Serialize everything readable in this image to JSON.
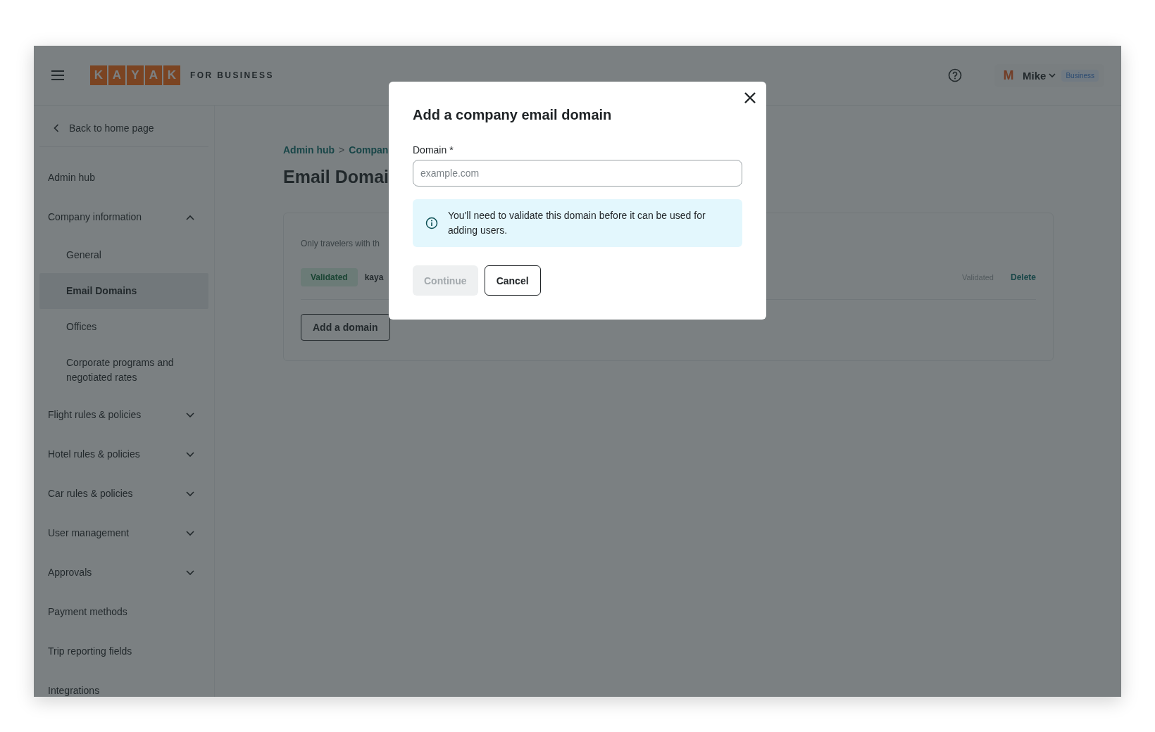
{
  "header": {
    "logo_letters": [
      "K",
      "A",
      "Y",
      "A",
      "K"
    ],
    "logo_tagline": "FOR BUSINESS",
    "user": {
      "initial": "M",
      "name": "Mike",
      "badge": "Business"
    }
  },
  "sidebar": {
    "back": "Back to home page",
    "items": [
      {
        "label": "Admin hub",
        "kind": "link",
        "selected": false
      },
      {
        "label": "Company information",
        "kind": "group",
        "expanded": true,
        "selected": false,
        "children": [
          {
            "label": "General",
            "selected": false
          },
          {
            "label": "Email Domains",
            "selected": true
          },
          {
            "label": "Offices",
            "selected": false
          },
          {
            "label": "Corporate programs and negotiated rates",
            "selected": false
          }
        ]
      },
      {
        "label": "Flight rules & policies",
        "kind": "group",
        "expanded": false,
        "selected": false
      },
      {
        "label": "Hotel rules & policies",
        "kind": "group",
        "expanded": false,
        "selected": false
      },
      {
        "label": "Car rules & policies",
        "kind": "group",
        "expanded": false,
        "selected": false
      },
      {
        "label": "User management",
        "kind": "group",
        "expanded": false,
        "selected": false
      },
      {
        "label": "Approvals",
        "kind": "group",
        "expanded": false,
        "selected": false
      },
      {
        "label": "Payment methods",
        "kind": "link",
        "selected": false
      },
      {
        "label": "Trip reporting fields",
        "kind": "link",
        "selected": false
      },
      {
        "label": "Integrations",
        "kind": "link",
        "selected": false
      }
    ]
  },
  "main": {
    "breadcrumb": [
      "Admin hub",
      "Compan"
    ],
    "breadcrumb_separator": ">",
    "title": "Email Domai",
    "card": {
      "note": "Only travelers with th",
      "domains": [
        {
          "status": "Validated",
          "domain": "kaya",
          "state_text": "Validated",
          "action": "Delete"
        }
      ],
      "add_button": "Add a domain"
    }
  },
  "modal": {
    "title": "Add a company email domain",
    "field_label": "Domain *",
    "placeholder": "example.com",
    "info": "You'll need to validate this domain before it can be used for adding users.",
    "buttons": [
      {
        "label": "Continue",
        "kind": "primary",
        "disabled": true
      },
      {
        "label": "Cancel",
        "kind": "secondary",
        "disabled": false
      }
    ]
  }
}
